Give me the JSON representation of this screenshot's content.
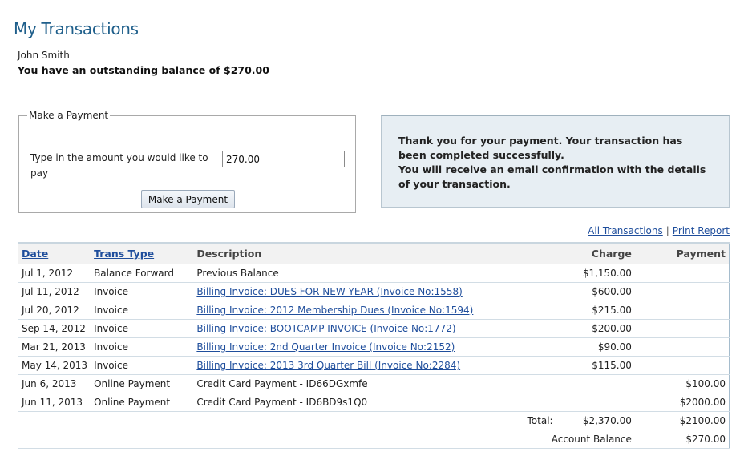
{
  "page": {
    "title": "My Transactions",
    "user_name": "John Smith",
    "balance_message": "You have an outstanding balance of $270.00"
  },
  "payment_form": {
    "legend": "Make a Payment",
    "amount_label": "Type in the amount you would like to pay",
    "amount_value": "270.00",
    "button_label": "Make a Payment"
  },
  "confirmation": {
    "line1": "Thank you for your payment. Your transaction has been completed successfully.",
    "line2": "You will receive an email confirmation with the details of your transaction."
  },
  "links": {
    "all_transactions": "All Transactions",
    "separator": "|",
    "print_report": "Print Report"
  },
  "table": {
    "headers": {
      "date": "Date",
      "trans_type": "Trans Type",
      "description": "Description",
      "charge": "Charge",
      "payment": "Payment"
    },
    "rows": [
      {
        "date": "Jul 1, 2012",
        "type": "Balance Forward",
        "description": "Previous Balance",
        "is_link": false,
        "charge": "$1,150.00",
        "payment": ""
      },
      {
        "date": "Jul 11, 2012",
        "type": "Invoice",
        "description": "Billing Invoice: DUES FOR NEW YEAR (Invoice No:1558)",
        "is_link": true,
        "charge": "$600.00",
        "payment": ""
      },
      {
        "date": "Jul 20, 2012",
        "type": "Invoice",
        "description": "Billing Invoice: 2012 Membership Dues (Invoice No:1594)",
        "is_link": true,
        "charge": "$215.00",
        "payment": ""
      },
      {
        "date": "Sep 14, 2012",
        "type": "Invoice",
        "description": "Billing Invoice: BOOTCAMP INVOICE (Invoice No:1772)",
        "is_link": true,
        "charge": "$200.00",
        "payment": ""
      },
      {
        "date": "Mar 21, 2013",
        "type": "Invoice",
        "description": "Billing Invoice: 2nd Quarter Invoice (Invoice No:2152)",
        "is_link": true,
        "charge": "$90.00",
        "payment": ""
      },
      {
        "date": "May 14, 2013",
        "type": "Invoice",
        "description": "Billing Invoice: 2013 3rd Quarter Bill (Invoice No:2284)",
        "is_link": true,
        "charge": "$115.00",
        "payment": ""
      },
      {
        "date": "Jun 6, 2013",
        "type": "Online Payment",
        "description": "Credit Card Payment - ID66DGxmfe",
        "is_link": false,
        "charge": "",
        "payment": "$100.00"
      },
      {
        "date": "Jun 11, 2013",
        "type": "Online Payment",
        "description": "Credit Card Payment - ID6BD9s1Q0",
        "is_link": false,
        "charge": "",
        "payment": "$2000.00"
      }
    ],
    "total": {
      "label": "Total:",
      "charge": "$2,370.00",
      "payment": "$2100.00"
    },
    "account_balance": {
      "label": "Account Balance",
      "value": "$270.00"
    }
  },
  "colors": {
    "title": "#1f5f8b",
    "link": "#1f4e9c",
    "confirm_bg": "#e7eef3",
    "table_border": "#a5bccd"
  }
}
